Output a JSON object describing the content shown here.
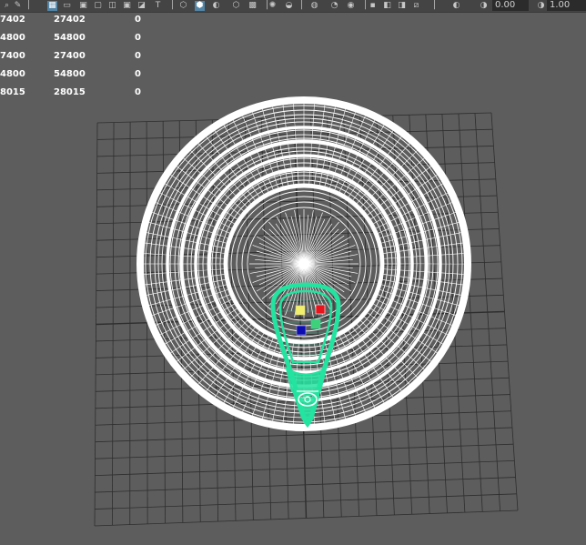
{
  "toolbar": {
    "icons": [
      {
        "name": "select-lasso-icon",
        "glyph": "⌕"
      },
      {
        "name": "paint-tool-icon",
        "glyph": "✎"
      },
      {
        "name": "separator-icon",
        "glyph": "│"
      },
      {
        "name": "grid-toggle-icon",
        "glyph": "▦"
      },
      {
        "name": "film-gate-icon",
        "glyph": "▭"
      },
      {
        "name": "resolution-gate-icon",
        "glyph": "▣"
      },
      {
        "name": "safe-action-icon",
        "glyph": "▢"
      },
      {
        "name": "field-chart-icon",
        "glyph": "◫"
      },
      {
        "name": "safe-title-icon",
        "glyph": "▣"
      },
      {
        "name": "gate-mask-icon",
        "glyph": "◪"
      },
      {
        "name": "text-annotation-icon",
        "glyph": "T"
      },
      {
        "name": "separator-icon-2",
        "glyph": "│"
      },
      {
        "name": "wireframe-cube-icon",
        "glyph": "⬡"
      },
      {
        "name": "smooth-shade-cube-icon",
        "glyph": "⬢"
      },
      {
        "name": "default-material-icon",
        "glyph": "◐"
      },
      {
        "name": "textured-cube-icon",
        "glyph": "⬡"
      },
      {
        "name": "checker-icon",
        "glyph": "▩"
      },
      {
        "name": "separator-icon-3",
        "glyph": "│"
      },
      {
        "name": "use-lights-icon",
        "glyph": "✺"
      },
      {
        "name": "shadows-icon",
        "glyph": "◒"
      },
      {
        "name": "separator-icon-4",
        "glyph": "│"
      },
      {
        "name": "ambient-occlusion-icon",
        "glyph": "◍"
      },
      {
        "name": "motion-blur-icon",
        "glyph": "◔"
      },
      {
        "name": "anti-aliasing-icon",
        "glyph": "◉"
      },
      {
        "name": "separator-icon-5",
        "glyph": "│"
      },
      {
        "name": "isolate-select-icon",
        "glyph": "▪"
      },
      {
        "name": "xray-icon",
        "glyph": "◧"
      },
      {
        "name": "xray-joints-icon",
        "glyph": "◨"
      },
      {
        "name": "xray-components-icon",
        "glyph": "⧄"
      },
      {
        "name": "separator-icon-6",
        "glyph": "│"
      },
      {
        "name": "camera-exposure-icon",
        "glyph": "◑"
      },
      {
        "name": "camera-gamma-icon",
        "glyph": "◐"
      }
    ],
    "exposure_value": "0.00",
    "gamma_value": "1.00"
  },
  "hud": {
    "rows": [
      {
        "label": "7402",
        "value": "27402",
        "extra": "0"
      },
      {
        "label": "4800",
        "value": "54800",
        "extra": "0"
      },
      {
        "label": "7400",
        "value": "27400",
        "extra": "0"
      },
      {
        "label": "4800",
        "value": "54800",
        "extra": "0"
      },
      {
        "label": "8015",
        "value": "28015",
        "extra": "0"
      }
    ]
  },
  "colors": {
    "background": "#5d5d5d",
    "grid": "#2e2e2e",
    "wireframe": "#ffffff",
    "selection": "#23e3a0",
    "locator_yellow": "#f2ef6b",
    "locator_red": "#e8141d",
    "locator_blue": "#0c0cb0",
    "locator_green": "#3fd07a",
    "toolbar_active": "#5285a6"
  }
}
